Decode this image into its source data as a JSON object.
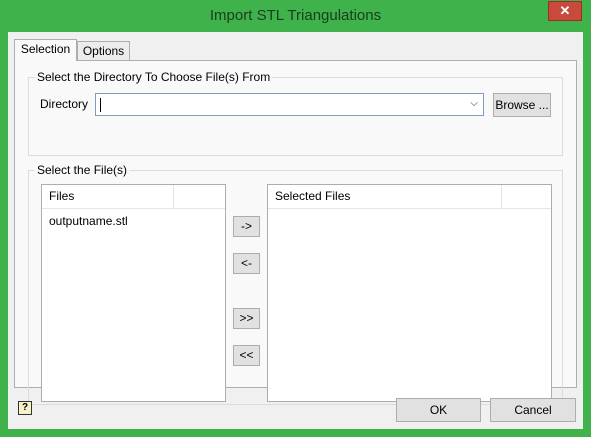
{
  "window": {
    "title": "Import STL Triangulations",
    "close_glyph": "✕"
  },
  "tabs": [
    {
      "label": "Selection",
      "active": true
    },
    {
      "label": "Options",
      "active": false
    }
  ],
  "directory_group": {
    "legend": "Select the Directory To Choose File(s) From",
    "directory_label": "Directory",
    "directory_value": "",
    "browse_label": "Browse ..."
  },
  "files_group": {
    "legend": "Select the File(s)",
    "files_header": "Files",
    "files": [
      "outputname.stl"
    ],
    "selected_header": "Selected Files",
    "selected_files": [],
    "add_label": "->",
    "remove_label": "<-",
    "add_all_label": ">>",
    "remove_all_label": "<<"
  },
  "footer": {
    "help_glyph": "?",
    "ok_label": "OK",
    "cancel_label": "Cancel"
  },
  "colors": {
    "titlebar": "#3fb24c",
    "close": "#c74a3c",
    "dialog_bg": "#f0f0f0"
  },
  "icons": {
    "help": "help-icon",
    "close": "close-icon",
    "dropdown": "chevron-down-icon"
  }
}
